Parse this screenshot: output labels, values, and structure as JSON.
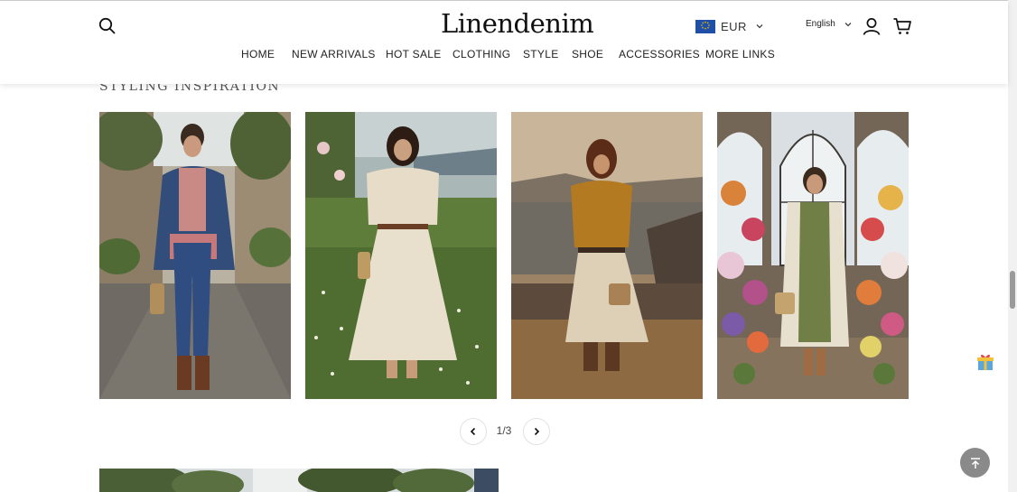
{
  "header": {
    "logo": "Linendenim",
    "currency": {
      "code": "EUR",
      "flag_icon": "eu-flag-icon"
    },
    "language": "English",
    "nav": [
      "HOME",
      "NEW ARRIVALS",
      "HOT SALE",
      "CLOTHING",
      "STYLE",
      "SHOE",
      "ACCESSORIES",
      "MORE LINKS"
    ]
  },
  "main": {
    "section_title": "STYLING INSPIRATION",
    "cards": [
      {
        "scene": "woman in denim jacket and jeans on cobblestone street"
      },
      {
        "scene": "woman in white linen skirt in wildflower meadow"
      },
      {
        "scene": "woman in mustard knit vest on seaside cliff at sunset"
      },
      {
        "scene": "woman in green linen dress in flower shop"
      }
    ],
    "pagination": {
      "label": "1/3"
    }
  },
  "colors": {
    "eu_blue": "#1f4fa6",
    "eu_star": "#f2c200",
    "back_to_top": "#8a8a8a"
  }
}
